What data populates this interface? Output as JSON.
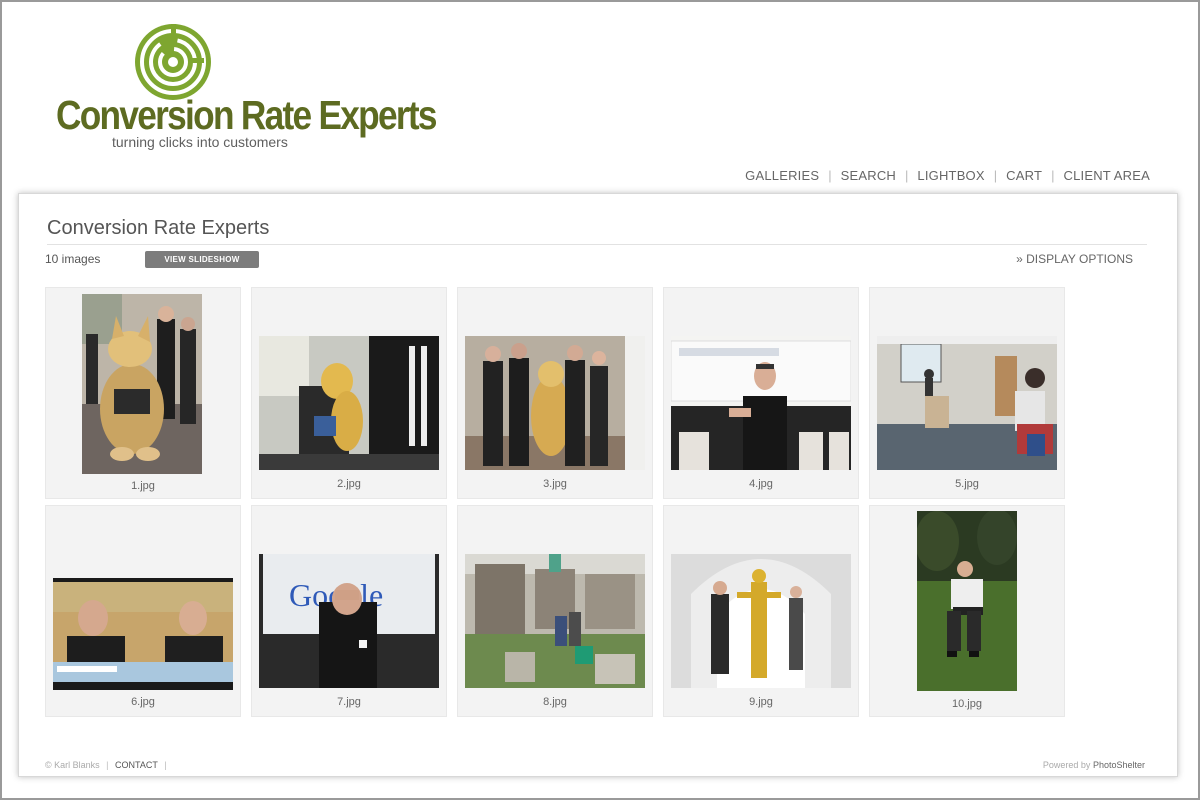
{
  "logo": {
    "name": "Conversion Rate Experts",
    "tagline": "turning clicks into customers",
    "brand_color": "#6a8a1c"
  },
  "nav": {
    "items": [
      "GALLERIES",
      "SEARCH",
      "LIGHTBOX",
      "CART",
      "CLIENT AREA"
    ]
  },
  "gallery": {
    "title": "Conversion Rate Experts",
    "count": "10 images",
    "slideshow_label": "VIEW SLIDESHOW",
    "display_options": "» DISPLAY OPTIONS",
    "images": [
      {
        "caption": "1.jpg"
      },
      {
        "caption": "2.jpg"
      },
      {
        "caption": "3.jpg"
      },
      {
        "caption": "4.jpg"
      },
      {
        "caption": "5.jpg"
      },
      {
        "caption": "6.jpg"
      },
      {
        "caption": "7.jpg"
      },
      {
        "caption": "8.jpg"
      },
      {
        "caption": "9.jpg"
      },
      {
        "caption": "10.jpg"
      }
    ]
  },
  "thumb_text": {
    "google": "Google"
  },
  "footer": {
    "copyright": "© Karl Blanks",
    "contact": "CONTACT",
    "powered_by": "Powered by",
    "brand": "PhotoShelter"
  }
}
